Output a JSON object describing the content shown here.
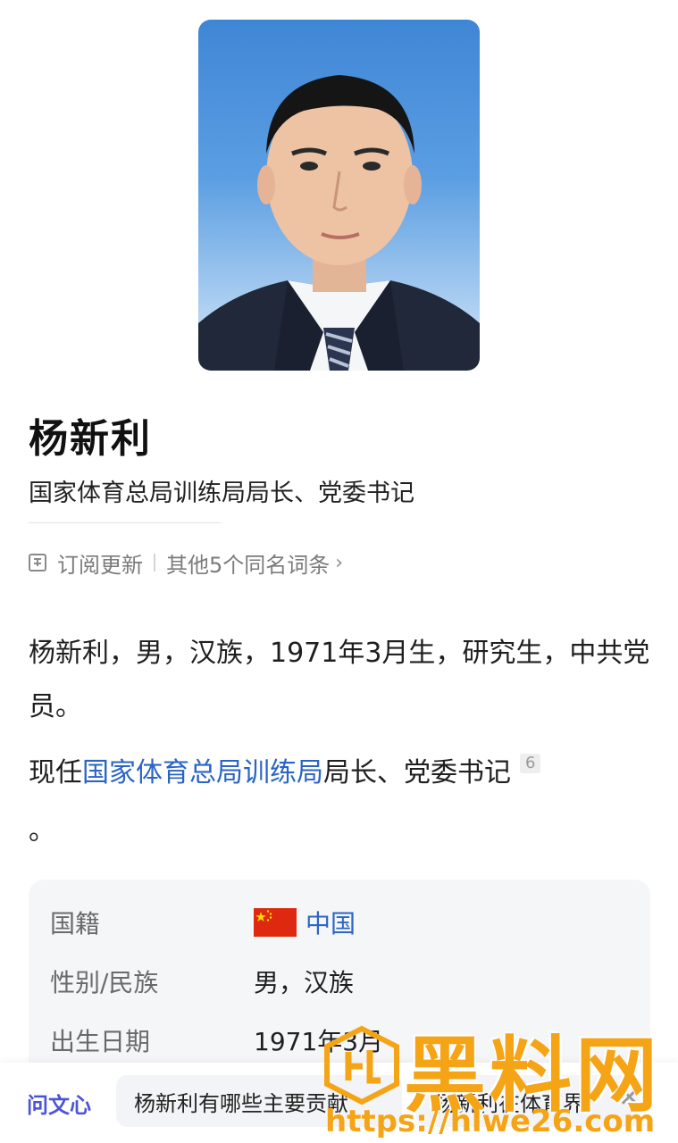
{
  "profile": {
    "name": "杨新利",
    "subtitle": "国家体育总局训练局局长、党委书记"
  },
  "meta": {
    "subscribe_label": "订阅更新",
    "other_entries_label": "其他5个同名词条"
  },
  "intro": {
    "text": "杨新利，男，汉族，1971年3月生，研究生，中共党员。"
  },
  "current_position": {
    "prefix": "现任",
    "link_text": "国家体育总局训练局",
    "suffix": "局长、党委书记",
    "reference": "6",
    "trailing": "。"
  },
  "infobox": {
    "rows": [
      {
        "key": "国籍",
        "value": "中国",
        "flag": "china-flag"
      },
      {
        "key": "性别/民族",
        "value": "男，汉族"
      },
      {
        "key": "出生日期",
        "value": "1971年3月"
      }
    ]
  },
  "bottom_bar": {
    "ai_label": "问文心",
    "suggestions": [
      "杨新利有哪些主要贡献",
      "杨新利在体育界"
    ],
    "close_icon": "close-icon"
  },
  "watermark": {
    "title": "黑料网",
    "url": "https://hlwe26.com"
  },
  "colors": {
    "link": "#2a64c5",
    "ai_accent": "#4b54d8",
    "watermark": "#f5a416"
  }
}
